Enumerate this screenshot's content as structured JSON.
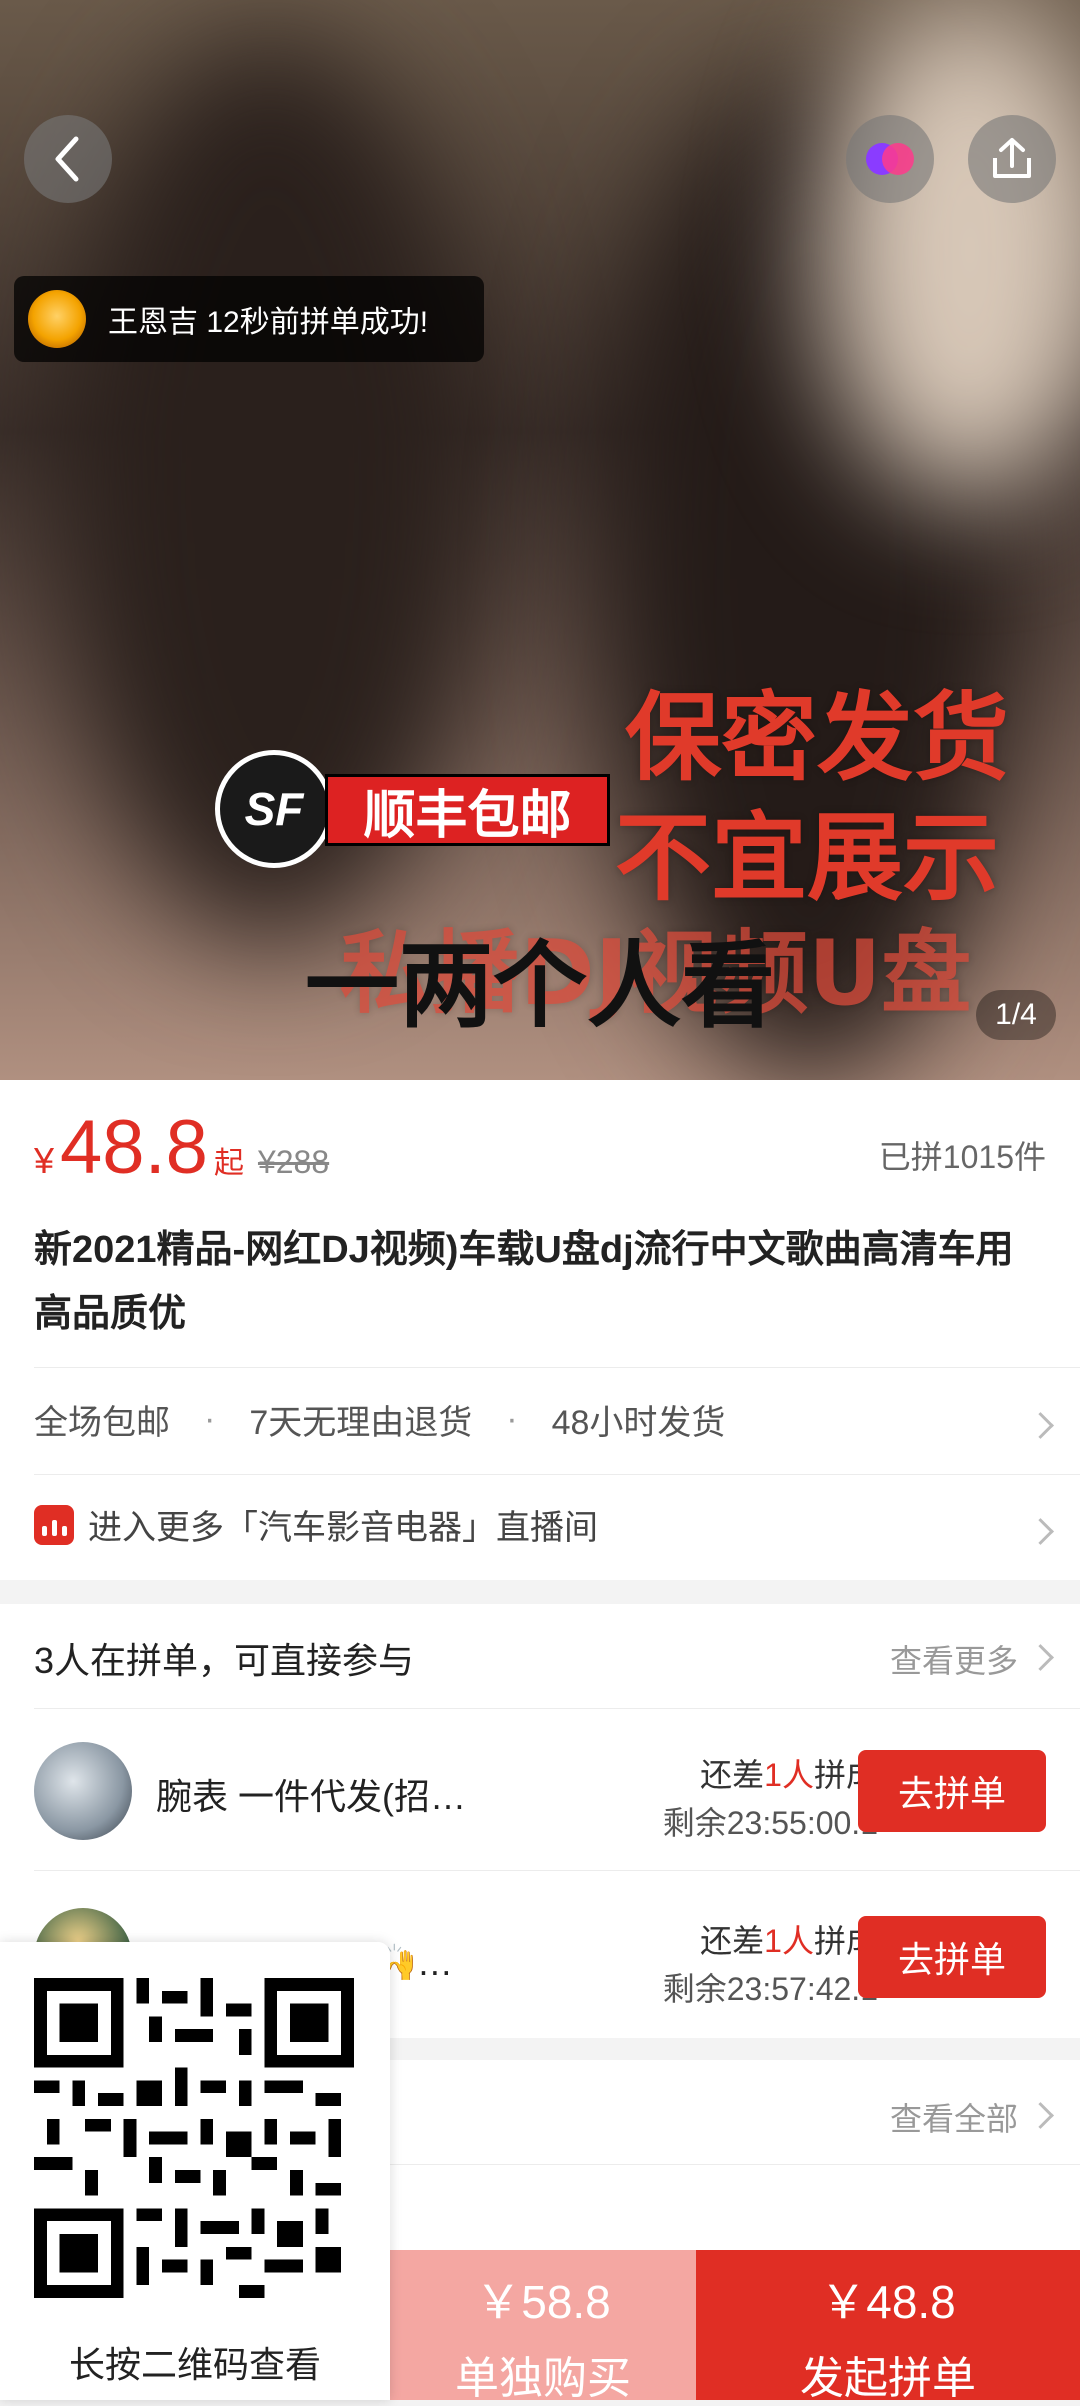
{
  "hero": {
    "toast_text": "王恩吉 12秒前拼单成功!",
    "overlay_lines": [
      "保密发货",
      "不宜展示"
    ],
    "sf_label": "顺丰包邮",
    "bottom_line": "一两个人看",
    "bottom_line_back": "私播DJ视频U盘",
    "pager": "1/4"
  },
  "price": {
    "currency": "¥",
    "current": "48.8",
    "suffix": "起",
    "original": "¥288",
    "sold": "已拼1015件"
  },
  "product": {
    "title": "新2021精品-网红DJ视频)车载U盘dj流行中文歌曲高清车用高品质优"
  },
  "services": [
    "全场包邮",
    "7天无理由退货",
    "48小时发货"
  ],
  "service_sep": "·",
  "live": {
    "text": "进入更多「汽车影音电器」直播间"
  },
  "group": {
    "header": "3人在拼单，可直接参与",
    "more": "查看更多",
    "items": [
      {
        "name": "腕表 一件代发(招…",
        "need_prefix": "还差",
        "need_count": "1人",
        "need_suffix": "拼成",
        "time": "剩余23:55:00.1",
        "button": "去拼单"
      },
      {
        "name": "…能使万骨全🙌…",
        "need_prefix": "还差",
        "need_count": "1人",
        "need_suffix": "拼成",
        "time": "剩余23:57:42.1",
        "button": "去拼单"
      }
    ]
  },
  "reviews": {
    "more": "查看全部"
  },
  "qr": {
    "caption": "长按二维码查看"
  },
  "bottom": {
    "single_price": "￥58.8",
    "single_label": "单独购买",
    "group_price": "￥48.8",
    "group_label": "发起拼单"
  },
  "colors": {
    "accent": "#e02e24",
    "single_bg": "#f4a7a2"
  }
}
